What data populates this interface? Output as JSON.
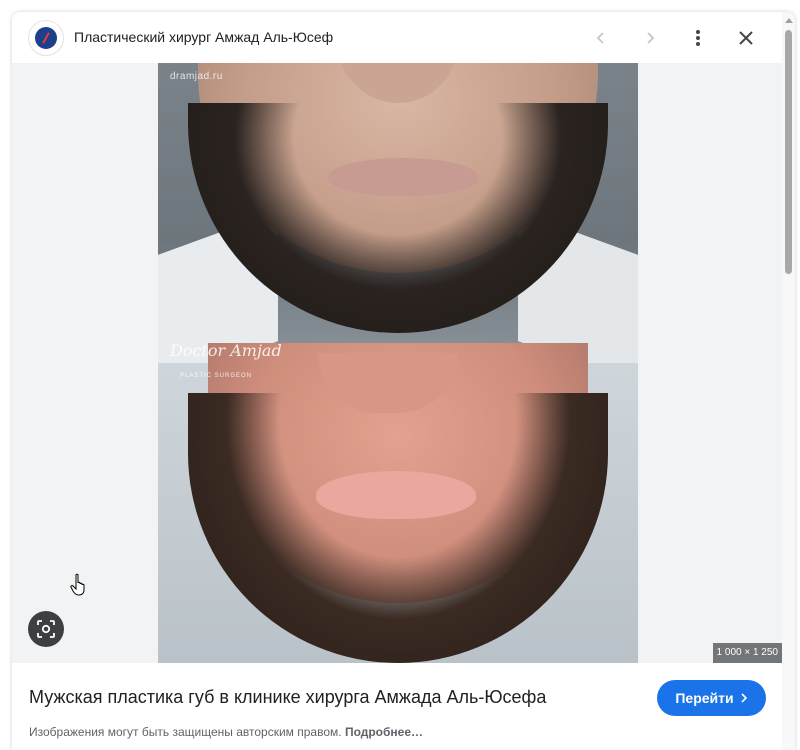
{
  "header": {
    "site_title": "Пластический хирург Амжад Аль-Юсеф",
    "favicon_icon": "site-logo-icon",
    "prev_icon": "chevron-left-icon",
    "next_icon": "chevron-right-icon",
    "more_icon": "more-vert-icon",
    "close_icon": "close-icon"
  },
  "image": {
    "watermark": "dramjad.ru",
    "signature": "Doctor Amjad",
    "signature_sub": "PLASTIC SURGEON",
    "dimensions": "1 000 × 1 250",
    "lens_icon": "lens-search-icon"
  },
  "footer": {
    "title": "Мужская пластика губ в клинике хирурга Амжада Аль-Юсефа",
    "go_label": "Перейти",
    "copyright_text": "Изображения могут быть защищены авторским правом.",
    "more_link": "Подробнее…"
  },
  "colors": {
    "accent": "#1a73e8",
    "text": "#202124",
    "muted": "#5f6368",
    "viewer_bg": "#f1f3f4"
  }
}
